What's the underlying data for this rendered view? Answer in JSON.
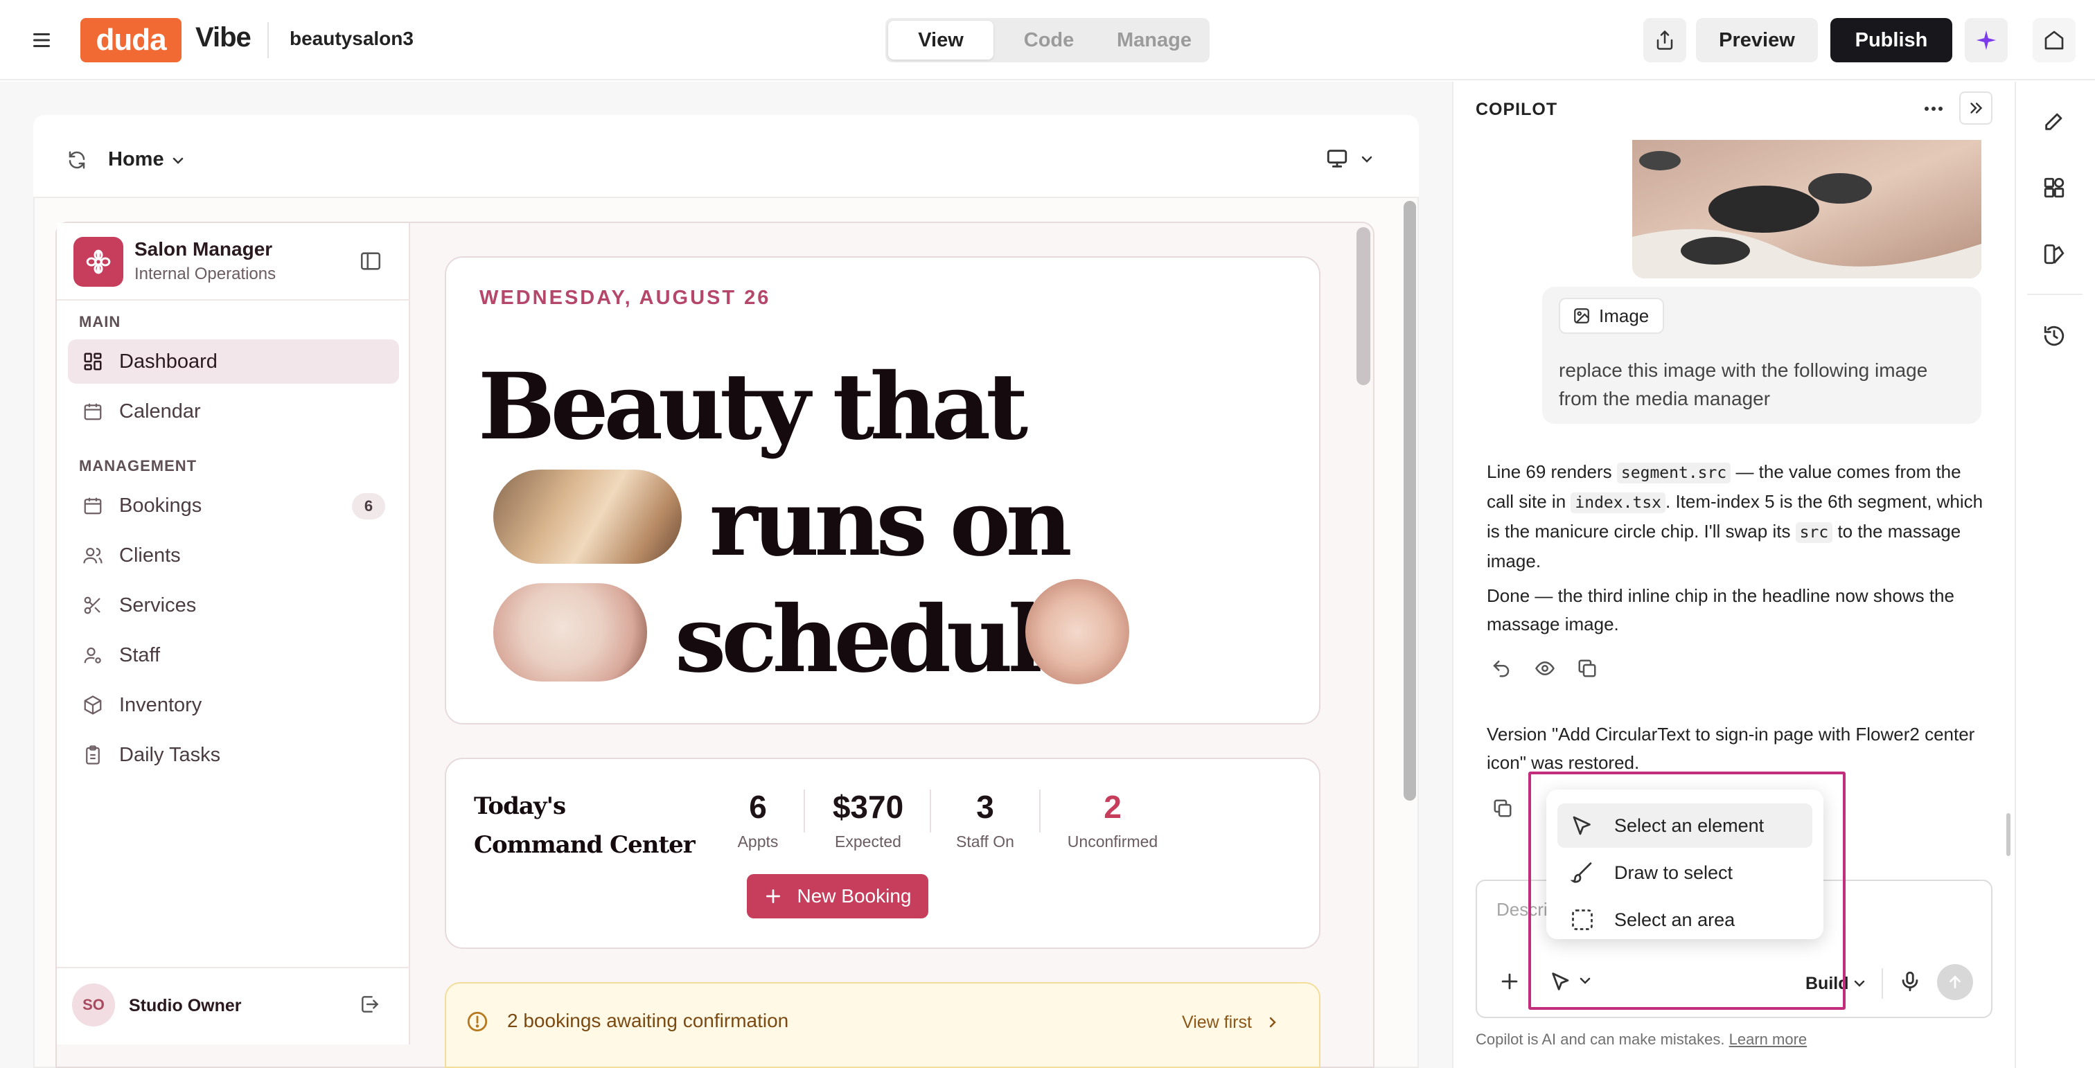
{
  "topbar": {
    "logo": "duda",
    "product": "Vibe",
    "site_name": "beautysalon3",
    "modes": [
      "View",
      "Code",
      "Manage"
    ],
    "active_mode": "View",
    "preview_label": "Preview",
    "publish_label": "Publish",
    "accent": "#7c3aed"
  },
  "canvas": {
    "page_name": "Home"
  },
  "site": {
    "brand": {
      "title": "Salon Manager",
      "subtitle": "Internal Operations",
      "color": "#c73e5d"
    },
    "sections": [
      {
        "label": "MAIN",
        "items": [
          {
            "label": "Dashboard",
            "icon": "layout-grid-icon",
            "active": true
          },
          {
            "label": "Calendar",
            "icon": "calendar-icon"
          }
        ]
      },
      {
        "label": "MANAGEMENT",
        "items": [
          {
            "label": "Bookings",
            "icon": "calendar-check-icon",
            "badge": "6"
          },
          {
            "label": "Clients",
            "icon": "users-icon"
          },
          {
            "label": "Services",
            "icon": "scissors-icon"
          },
          {
            "label": "Staff",
            "icon": "user-cog-icon"
          },
          {
            "label": "Inventory",
            "icon": "package-icon"
          },
          {
            "label": "Daily Tasks",
            "icon": "clipboard-icon"
          }
        ]
      }
    ],
    "user": {
      "initials": "SO",
      "name": "Studio Owner"
    },
    "hero": {
      "date": "WEDNESDAY, AUGUST 26",
      "line1": "Beauty that",
      "line2": "runs on",
      "line3": "schedule"
    },
    "command_center": {
      "title": "Today's Command Center",
      "stats": [
        {
          "value": "6",
          "label": "Appts"
        },
        {
          "value": "$370",
          "label": "Expected"
        },
        {
          "value": "3",
          "label": "Staff On"
        },
        {
          "value": "2",
          "label": "Unconfirmed",
          "highlight": true
        }
      ],
      "new_booking_label": "New Booking"
    },
    "alert": {
      "text": "2 bookings awaiting confirmation",
      "action": "View first"
    }
  },
  "copilot": {
    "title": "COPILOT",
    "user_message": {
      "attachment_label": "Image",
      "text": "replace this image with the following image from the media manager"
    },
    "ai_message": {
      "p1_a": "Line 69 renders ",
      "code1": "segment.src",
      "p1_b": " — the value comes from the call site in ",
      "code2": "index.tsx",
      "p1_c": ". Item-index 5 is the 6th segment, which is the manicure circle chip. I'll swap its ",
      "code3": "src",
      "p1_d": " to the massage image.",
      "p2": "Done — the third inline chip in the headline now shows the massage image."
    },
    "restore_message": "Version \"Add CircularText to sign-in page with Flower2 center icon\" was restored.",
    "composer_placeholder": "Describe",
    "select_menu": [
      {
        "label": "Select an element",
        "icon": "cursor-pointer-icon",
        "active": true
      },
      {
        "label": "Draw to select",
        "icon": "brush-icon"
      },
      {
        "label": "Select an area",
        "icon": "dashed-square-icon"
      }
    ],
    "mode_label": "Build",
    "disclaimer": "Copilot is AI and can make mistakes.",
    "learn_more": "Learn more"
  }
}
